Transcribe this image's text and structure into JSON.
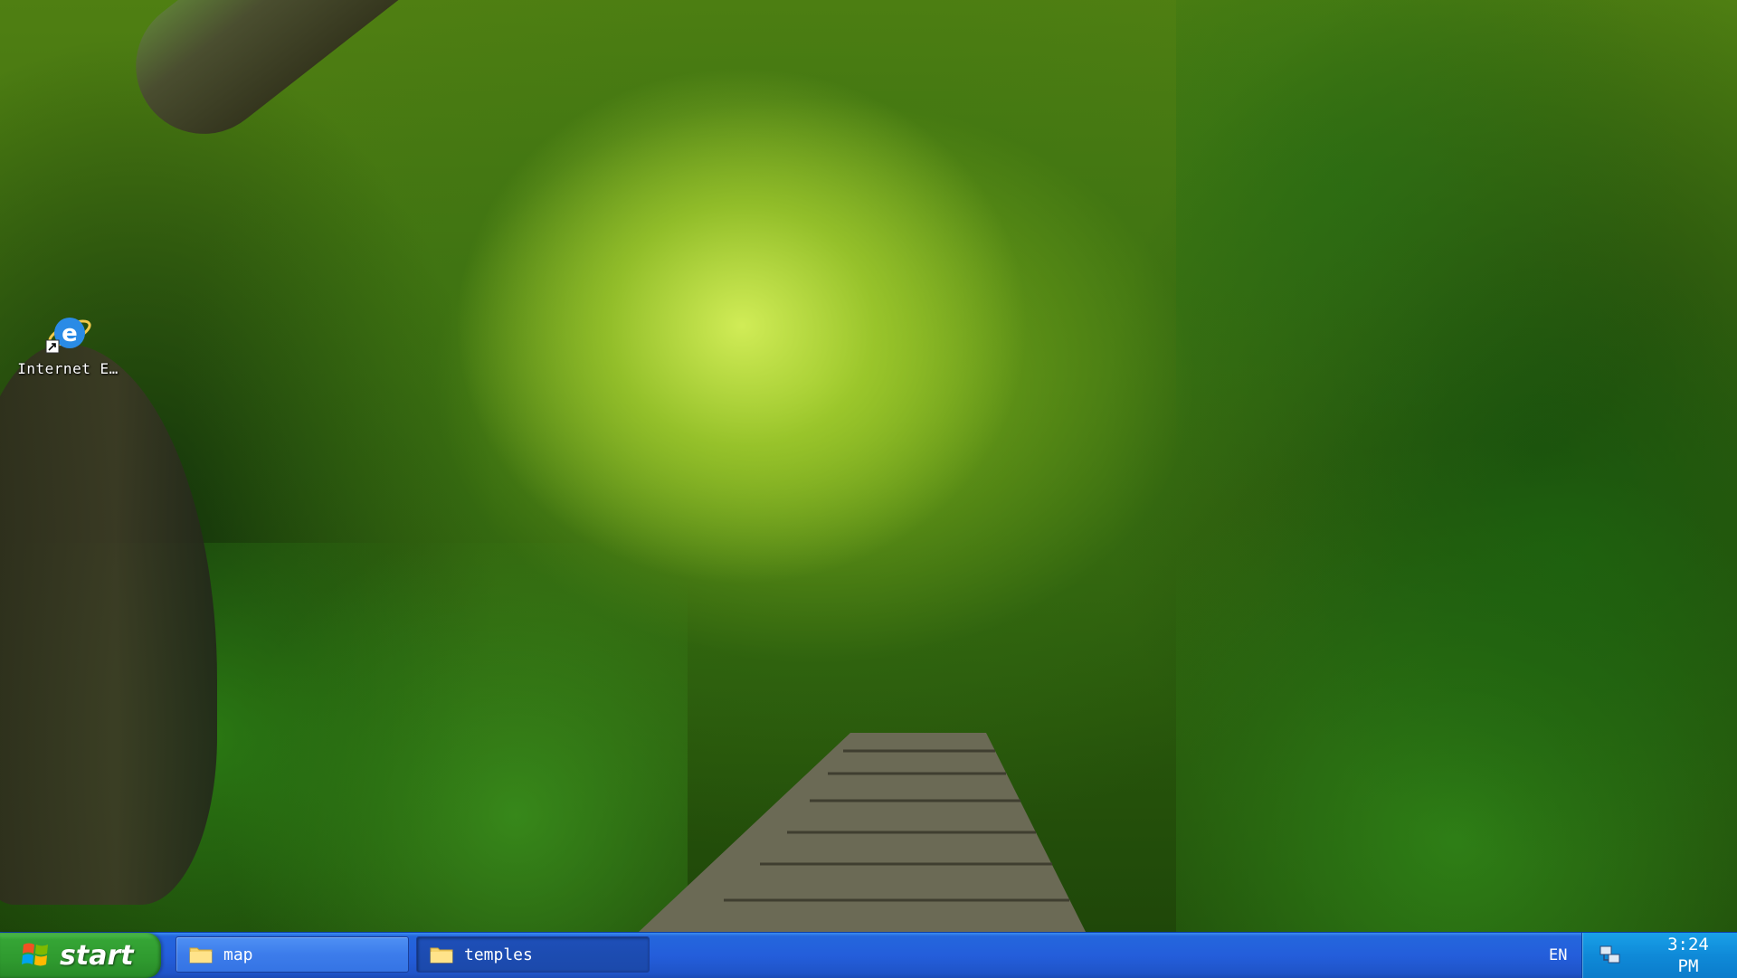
{
  "desktop": {
    "wallpaper": "jungle-boardwalk-wallpaper",
    "icons": [
      {
        "label": "Internet E…",
        "icon": "internet-explorer-icon"
      }
    ]
  },
  "taskbar": {
    "start_label": "start",
    "items": [
      {
        "label": "map",
        "icon": "folder-icon",
        "state": "inactive"
      },
      {
        "label": "temples",
        "icon": "folder-icon",
        "state": "active"
      }
    ],
    "language": "EN",
    "tray_icon": "network-icon",
    "clock": {
      "time": "3:24",
      "meridiem": "PM"
    }
  },
  "colors": {
    "taskbar_blue": "#245edb",
    "start_green": "#35a535",
    "tray_blue": "#0f8ad8"
  }
}
